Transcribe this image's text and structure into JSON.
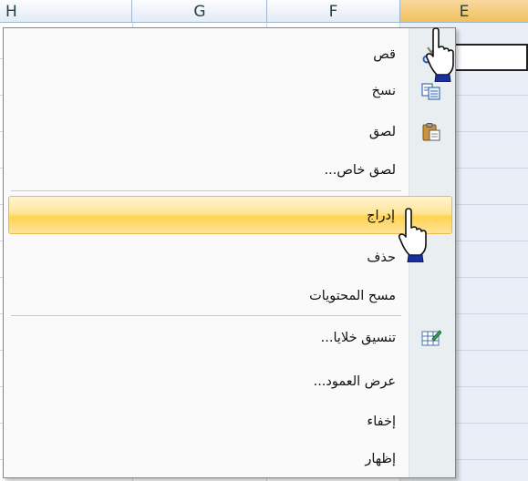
{
  "columns": [
    "H",
    "G",
    "F",
    "E"
  ],
  "selected_column": "E",
  "context_menu": {
    "items": [
      {
        "label": "قص",
        "icon": "scissors-icon"
      },
      {
        "label": "نسخ",
        "icon": "copy-icon"
      },
      {
        "label": "لصق",
        "icon": "paste-icon"
      },
      {
        "label": "لصق خاص...",
        "icon": ""
      },
      {
        "label": "إدراج",
        "icon": "",
        "highlighted": true
      },
      {
        "label": "حذف",
        "icon": ""
      },
      {
        "label": "مسح المحتويات",
        "icon": ""
      },
      {
        "label": "تنسيق خلايا...",
        "icon": "format-cells-icon"
      },
      {
        "label": "عرض العمود...",
        "icon": ""
      },
      {
        "label": "إخفاء",
        "icon": ""
      },
      {
        "label": "إظهار",
        "icon": ""
      }
    ]
  },
  "colors": {
    "highlight": "#ffd351",
    "header_selected": "#f1c15f",
    "grid_line": "#d0d7e5",
    "cursor_cuff": "#1a2f9e"
  }
}
